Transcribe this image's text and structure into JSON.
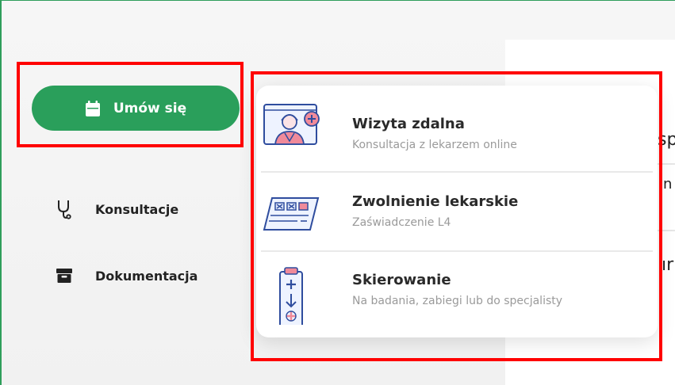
{
  "sidebar": {
    "book_button": {
      "label": "Umów się",
      "icon": "calendar-icon"
    },
    "items": [
      {
        "label": "Konsultacje",
        "icon": "stethoscope-icon"
      },
      {
        "label": "Dokumentacja",
        "icon": "archive-box-icon"
      }
    ]
  },
  "menu": {
    "items": [
      {
        "title": "Wizyta zdalna",
        "subtitle": "Konsultacja z lekarzem online",
        "icon": "doctor-video-illustration"
      },
      {
        "title": "Zwolnienie lekarskie",
        "subtitle": "Zaświadczenie L4",
        "icon": "sick-leave-form-illustration"
      },
      {
        "title": "Skierowanie",
        "subtitle": "Na badania, zabiegi lub do specjalisty",
        "icon": "referral-clipboard-illustration"
      }
    ]
  },
  "background_fragments": [
    "sp",
    "n",
    "ır"
  ],
  "colors": {
    "primary_green": "#2a9f5b",
    "highlight_red": "#ff0000",
    "illustration_blue": "#2f4d9e",
    "illustration_pink": "#f08a9a"
  }
}
